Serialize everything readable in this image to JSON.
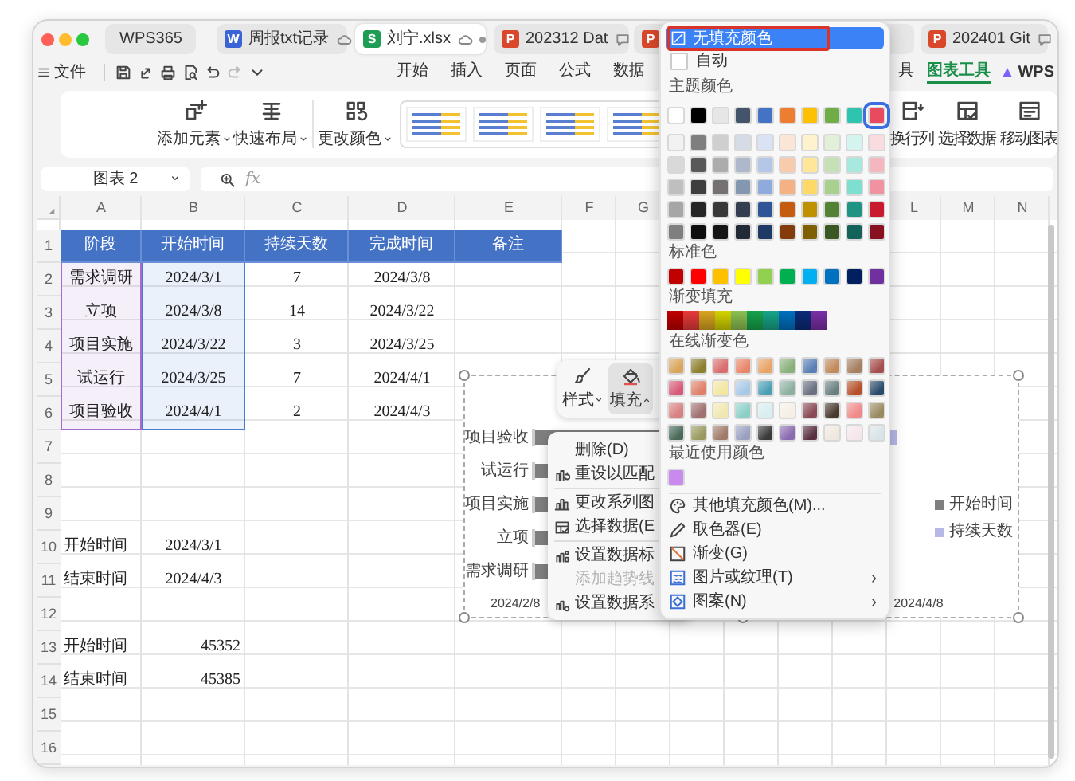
{
  "window": {
    "tabs": [
      {
        "kind": "wps",
        "label": "WPS365",
        "selected": false
      },
      {
        "kind": "doc",
        "badge": "W",
        "label": "周报txt记录",
        "cloud": true,
        "selected": false
      },
      {
        "kind": "sheet",
        "badge": "S",
        "label": "刘宁.xlsx",
        "cloud": true,
        "unsaved": true,
        "selected": true
      },
      {
        "kind": "ppt",
        "badge": "P",
        "label": "202312 Dat",
        "comment": true,
        "selected": false
      },
      {
        "kind": "ppt",
        "badge": "P",
        "selected": false
      },
      {
        "kind": "ppt",
        "badge": "P",
        "label": "202401 Git",
        "comment": true,
        "selected": false
      }
    ]
  },
  "menu": {
    "file": "文件",
    "quick_access": [
      {
        "kind": "save",
        "disabled": false
      },
      {
        "kind": "share",
        "disabled": false
      },
      {
        "kind": "print",
        "disabled": false
      },
      {
        "kind": "preview",
        "disabled": false
      },
      {
        "kind": "undo",
        "disabled": false
      },
      {
        "kind": "redo",
        "disabled": true
      },
      {
        "kind": "more",
        "disabled": false
      }
    ],
    "tabs_left": [
      {
        "label": "开始",
        "selected": false
      },
      {
        "label": "插入",
        "selected": false
      },
      {
        "label": "页面",
        "selected": false
      },
      {
        "label": "公式",
        "selected": false
      },
      {
        "label": "数据",
        "selected": false
      }
    ],
    "tabs_right": [
      {
        "label": "具",
        "selected": false
      },
      {
        "label": "图表工具",
        "selected": true
      }
    ],
    "ai_label": "WPS"
  },
  "ribbon": {
    "buttons": [
      {
        "kind": "add",
        "label": "添加元素",
        "dropdown": true
      },
      {
        "kind": "layout",
        "label": "快速布局",
        "dropdown": true
      },
      {
        "kind": "recolor",
        "label": "更改颜色",
        "dropdown": true
      }
    ],
    "right_buttons": [
      {
        "kind": "swap",
        "label": "换行列",
        "dropdown": false
      },
      {
        "kind": "data",
        "label": "选择数据",
        "dropdown": false
      },
      {
        "kind": "move",
        "label": "移动图表",
        "dropdown": false
      }
    ]
  },
  "formula_bar": {
    "name_box": "图表 2",
    "fx": "fx"
  },
  "sheet": {
    "columns": [
      {
        "label": "A",
        "color": "#a66bd3"
      },
      {
        "label": "B",
        "color": "#4a7bd0"
      },
      {
        "label": "C"
      },
      {
        "label": "D"
      },
      {
        "label": "E"
      },
      {
        "label": "F"
      },
      {
        "label": "G"
      },
      {
        "label": "L"
      },
      {
        "label": "M"
      },
      {
        "label": "N"
      }
    ],
    "rows": [
      {
        "number": "1",
        "kind": "header",
        "cells": [
          "阶段",
          "开始时间",
          "持续天数",
          "完成时间",
          "备注"
        ]
      },
      {
        "number": "2",
        "kind": "table",
        "cells": [
          "需求调研",
          "2024/3/1",
          "7",
          "2024/3/8"
        ]
      },
      {
        "number": "3",
        "kind": "table",
        "cells": [
          "立项",
          "2024/3/8",
          "14",
          "2024/3/22"
        ]
      },
      {
        "number": "4",
        "kind": "table",
        "cells": [
          "项目实施",
          "2024/3/22",
          "3",
          "2024/3/25"
        ]
      },
      {
        "number": "5",
        "kind": "table",
        "cells": [
          "试运行",
          "2024/3/25",
          "7",
          "2024/4/1"
        ]
      },
      {
        "number": "6",
        "kind": "table",
        "cells": [
          "项目验收",
          "2024/4/1",
          "2",
          "2024/4/3"
        ]
      },
      {
        "number": "7",
        "kind": "blank"
      },
      {
        "number": "8",
        "kind": "blank"
      },
      {
        "number": "9",
        "kind": "blank"
      },
      {
        "number": "10",
        "kind": "label",
        "cells": [
          "开始时间",
          "2024/3/1"
        ]
      },
      {
        "number": "11",
        "kind": "label",
        "cells": [
          "结束时间",
          "2024/4/3"
        ]
      },
      {
        "number": "12",
        "kind": "blank"
      },
      {
        "number": "13",
        "kind": "serial",
        "cells": [
          "开始时间",
          "45352"
        ]
      },
      {
        "number": "14",
        "kind": "serial",
        "cells": [
          "结束时间",
          "45385"
        ]
      },
      {
        "number": "15",
        "kind": "blank"
      },
      {
        "number": "16",
        "kind": "blank"
      }
    ]
  },
  "chart": {
    "categories": [
      "项目验收",
      "试运行",
      "项目实施",
      "立项",
      "需求调研"
    ],
    "axis_labels": [
      "2024/2/8",
      "2024/4/8"
    ],
    "legend": [
      {
        "label": "开始时间",
        "color": "#7f7f7f"
      },
      {
        "label": "持续天数",
        "color": "#b8b8e8"
      }
    ]
  },
  "floating_toolbar": {
    "buttons": [
      {
        "kind": "style",
        "label": "样式",
        "selected": false
      },
      {
        "kind": "fill",
        "label": "填充",
        "selected": true
      }
    ]
  },
  "context_menu": {
    "items": [
      {
        "kind": "command",
        "label": "删除(D)",
        "disabled": false
      },
      {
        "kind": "command",
        "label": "重设以匹配",
        "disabled": false
      },
      {
        "kind": "separator"
      },
      {
        "kind": "command",
        "label": "更改系列图",
        "disabled": false
      },
      {
        "kind": "command",
        "label": "选择数据(E",
        "disabled": false
      },
      {
        "kind": "separator"
      },
      {
        "kind": "command",
        "label": "设置数据标",
        "disabled": false
      },
      {
        "kind": "command",
        "label": "添加趋势线",
        "disabled": true
      },
      {
        "kind": "command",
        "label": "设置数据系",
        "disabled": false
      }
    ]
  },
  "fill_menu": {
    "no_fill": {
      "label": "无填充颜色",
      "selected": true,
      "annotated": true
    },
    "automatic": {
      "label": "自动",
      "selected": false
    },
    "theme_label": "主题颜色",
    "theme": [
      {
        "color": "#ffffff",
        "selected": false
      },
      {
        "color": "#000000",
        "selected": false
      },
      {
        "color": "#e7e6e6",
        "selected": false
      },
      {
        "color": "#44546a",
        "selected": false
      },
      {
        "color": "#4472c4",
        "selected": false
      },
      {
        "color": "#ed7d31",
        "selected": false
      },
      {
        "color": "#ffc000",
        "selected": false
      },
      {
        "color": "#70ad47",
        "selected": false
      },
      {
        "color": "#2ec4b0",
        "selected": false
      },
      {
        "color": "#e84a5f",
        "selected": true
      }
    ],
    "shades": [
      [
        {
          "color": "#f2f2f2"
        },
        {
          "color": "#7f7f7f"
        },
        {
          "color": "#d0cece"
        },
        {
          "color": "#d6dce5"
        },
        {
          "color": "#dae3f3"
        },
        {
          "color": "#fbe5d6"
        },
        {
          "color": "#fff2cc"
        },
        {
          "color": "#e2f0d9"
        },
        {
          "color": "#d4f4ef"
        },
        {
          "color": "#fadbdf"
        }
      ],
      [
        {
          "color": "#d9d9d9"
        },
        {
          "color": "#595959"
        },
        {
          "color": "#aeabab"
        },
        {
          "color": "#adb9ca"
        },
        {
          "color": "#b4c7e7"
        },
        {
          "color": "#f8cbad"
        },
        {
          "color": "#ffe699"
        },
        {
          "color": "#c5e0b4"
        },
        {
          "color": "#a8e9df"
        },
        {
          "color": "#f5b7bf"
        }
      ],
      [
        {
          "color": "#bfbfbf"
        },
        {
          "color": "#3f3f3f"
        },
        {
          "color": "#757171"
        },
        {
          "color": "#8497b0"
        },
        {
          "color": "#8faadc"
        },
        {
          "color": "#f4b183"
        },
        {
          "color": "#ffd966"
        },
        {
          "color": "#a9d18e"
        },
        {
          "color": "#7ddfd0"
        },
        {
          "color": "#f0929f"
        }
      ],
      [
        {
          "color": "#a6a6a6"
        },
        {
          "color": "#262626"
        },
        {
          "color": "#3a3838"
        },
        {
          "color": "#333f50"
        },
        {
          "color": "#2f5597"
        },
        {
          "color": "#c55a11"
        },
        {
          "color": "#bf9000"
        },
        {
          "color": "#548235"
        },
        {
          "color": "#1f9484"
        },
        {
          "color": "#c8192f"
        }
      ],
      [
        {
          "color": "#7f7f7f"
        },
        {
          "color": "#0d0d0d"
        },
        {
          "color": "#171616"
        },
        {
          "color": "#222a35"
        },
        {
          "color": "#203864"
        },
        {
          "color": "#843c0c"
        },
        {
          "color": "#7f6000"
        },
        {
          "color": "#385723"
        },
        {
          "color": "#14635a"
        },
        {
          "color": "#86111f"
        }
      ]
    ],
    "standard_label": "标准色",
    "standard": [
      {
        "color": "#c00000"
      },
      {
        "color": "#ff0000"
      },
      {
        "color": "#ffc000"
      },
      {
        "color": "#ffff00"
      },
      {
        "color": "#92d050"
      },
      {
        "color": "#00b050"
      },
      {
        "color": "#00b0f0"
      },
      {
        "color": "#0070c0"
      },
      {
        "color": "#002060"
      },
      {
        "color": "#7030a0"
      }
    ],
    "gradient_label": "渐变填充",
    "gradients": [
      {
        "color": "#c00000"
      },
      {
        "color": "#e83a3a"
      },
      {
        "color": "#d9a521"
      },
      {
        "color": "#d4d400"
      },
      {
        "color": "#8cc152"
      },
      {
        "color": "#16a34a"
      },
      {
        "color": "#17a589"
      },
      {
        "color": "#0070c0"
      },
      {
        "color": "#0b2a78"
      },
      {
        "color": "#7b2fa8"
      }
    ],
    "online_label": "在线渐变色",
    "online": [
      [
        {
          "color": "#d9a55a"
        },
        {
          "color": "#8c7f2e"
        },
        {
          "color": "#d96c6c"
        },
        {
          "color": "#e8866a"
        },
        {
          "color": "#e8a366"
        },
        {
          "color": "#88b07a"
        },
        {
          "color": "#5a7fb5"
        },
        {
          "color": "#c08a5a"
        },
        {
          "color": "#a57f60"
        },
        {
          "color": "#a64d4d"
        }
      ],
      [
        {
          "color": "#d65a78"
        },
        {
          "color": "#e0806a"
        },
        {
          "color": "#f2e6a0"
        },
        {
          "color": "#a8c8e8"
        },
        {
          "color": "#4a9fb5"
        },
        {
          "color": "#8cb0a0"
        },
        {
          "color": "#6a7080"
        },
        {
          "color": "#6a8080"
        },
        {
          "color": "#b5502a"
        },
        {
          "color": "#2a4a6a"
        }
      ],
      [
        {
          "color": "#d98080"
        },
        {
          "color": "#a07070"
        },
        {
          "color": "#f0e8b0"
        },
        {
          "color": "#8ccfc8"
        },
        {
          "color": "#d8eef0"
        },
        {
          "color": "#f5efe6"
        },
        {
          "color": "#8a4a55"
        },
        {
          "color": "#4a3a2e"
        },
        {
          "color": "#f08a8a"
        },
        {
          "color": "#9a8a60"
        }
      ],
      [
        {
          "color": "#4a6a5a"
        },
        {
          "color": "#9a9a60"
        },
        {
          "color": "#a07a6a"
        },
        {
          "color": "#9aa0c0"
        },
        {
          "color": "#3a3a3a"
        },
        {
          "color": "#8a6ab0"
        },
        {
          "color": "#5a3040"
        },
        {
          "color": "#efe8de"
        },
        {
          "color": "#f5e6ec"
        },
        {
          "color": "#d8e4e8"
        }
      ]
    ],
    "recent_label": "最近使用颜色",
    "recent": [
      {
        "color": "#c98af0"
      }
    ],
    "commands": [
      {
        "label": "其他填充颜色(M)...",
        "submenu": false
      },
      {
        "label": "取色器(E)",
        "submenu": false
      },
      {
        "label": "渐变(G)",
        "submenu": false
      },
      {
        "label": "图片或纹理(T)",
        "submenu": true
      },
      {
        "label": "图案(N)",
        "submenu": true
      }
    ]
  }
}
